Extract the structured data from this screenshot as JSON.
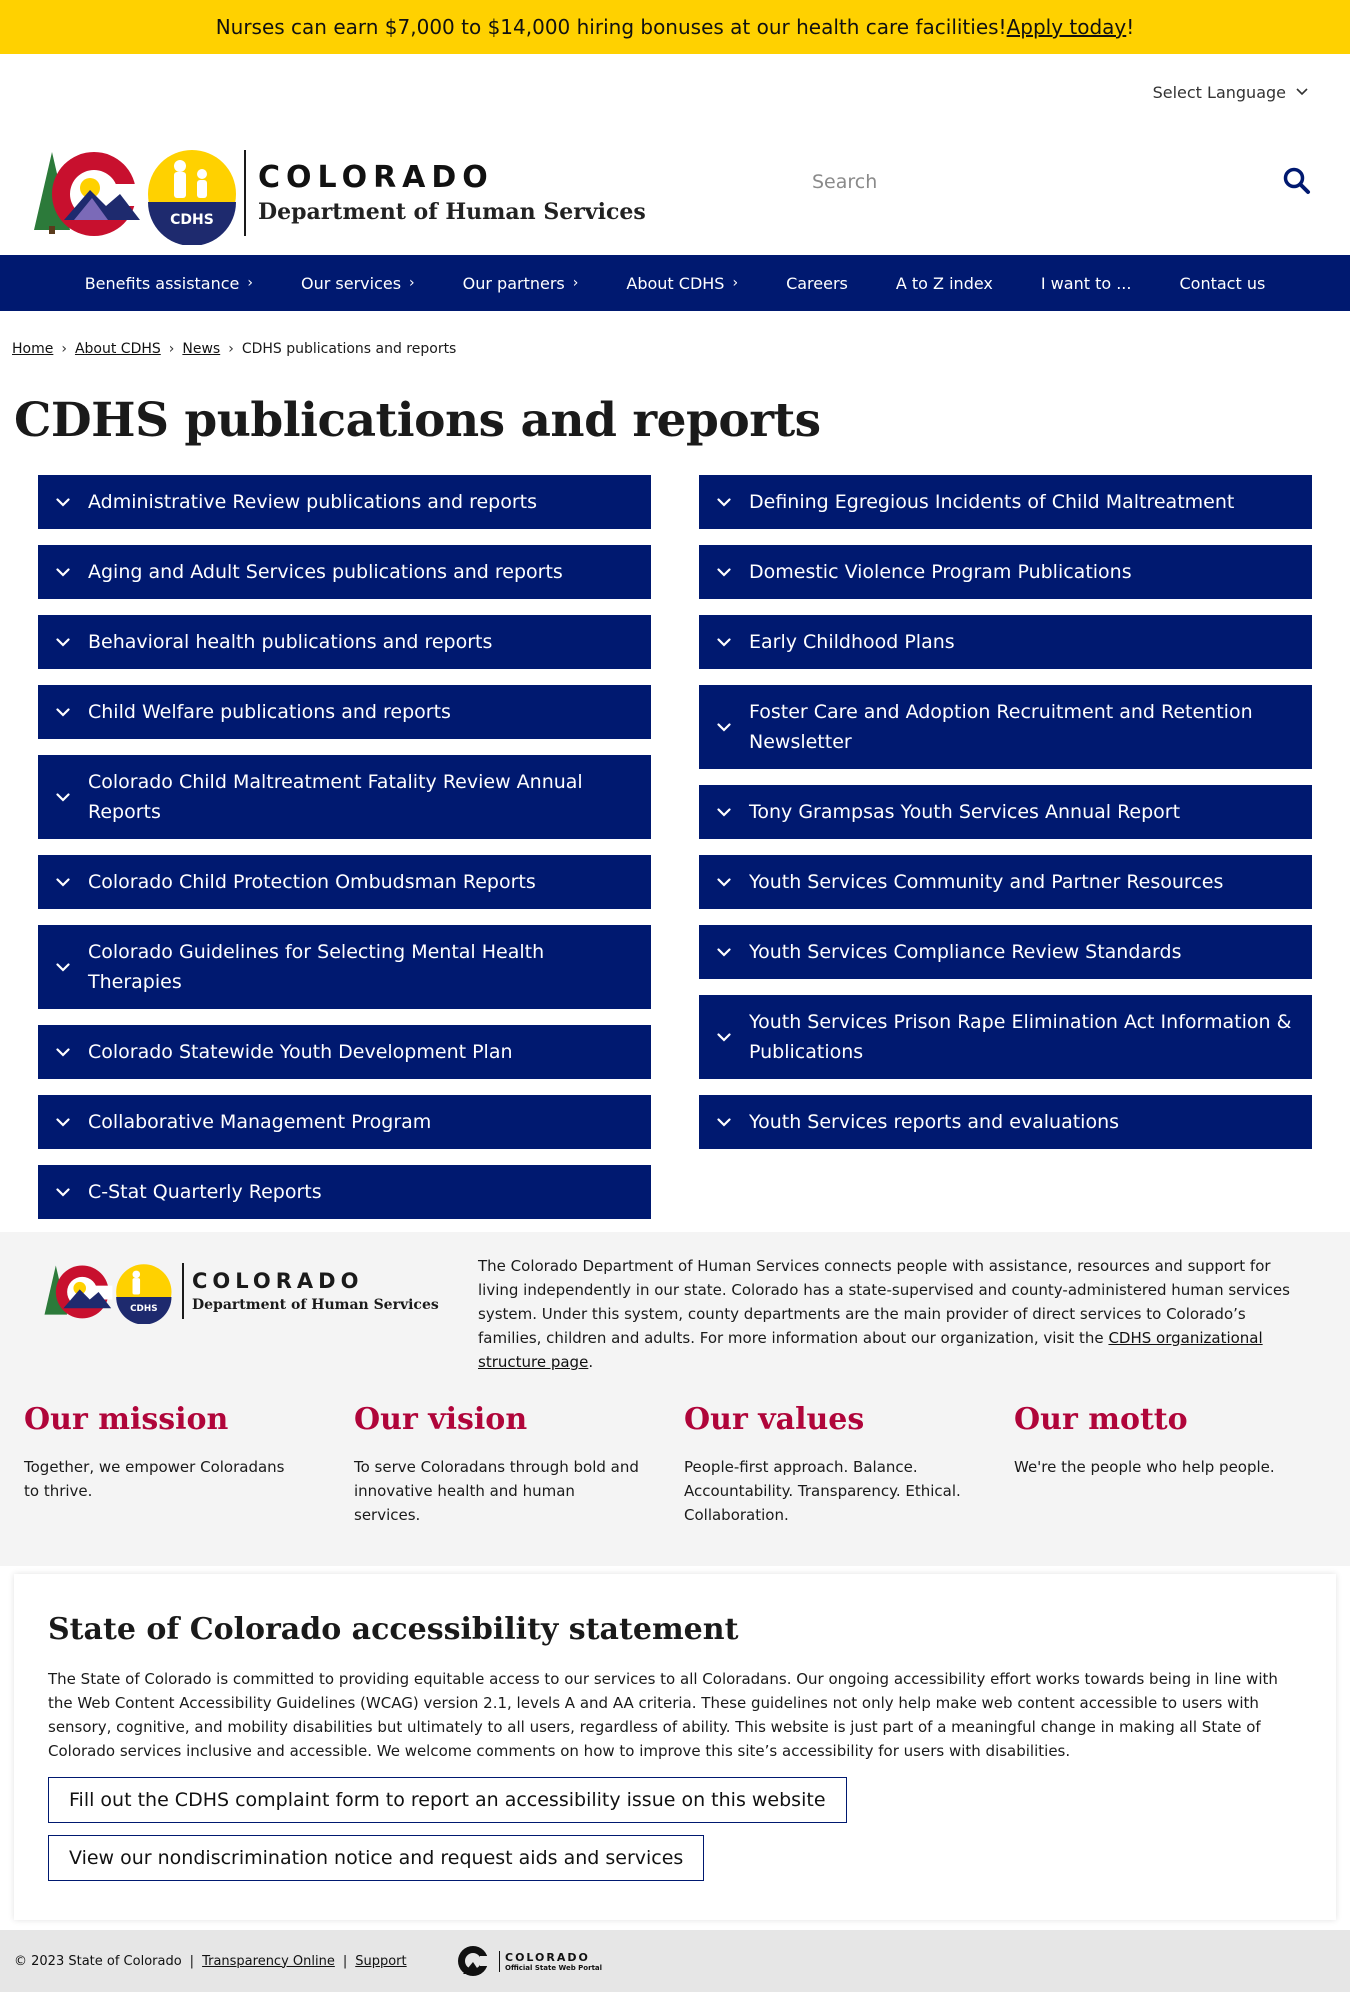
{
  "banner": {
    "text": "Nurses can earn $7,000 to $14,000 hiring bonuses at our health care facilities! ",
    "link": "Apply today",
    "suffix": "!"
  },
  "header": {
    "language_label": "Select Language",
    "logo_title": "COLORADO",
    "logo_subtitle": "Department of Human Services",
    "logo_badge": "CDHS",
    "search_placeholder": "Search"
  },
  "nav": {
    "items": [
      {
        "label": "Benefits assistance",
        "arrow": true
      },
      {
        "label": "Our services",
        "arrow": true
      },
      {
        "label": "Our partners",
        "arrow": true
      },
      {
        "label": "About CDHS",
        "arrow": true
      },
      {
        "label": "Careers",
        "arrow": false
      },
      {
        "label": "A to Z index",
        "arrow": false
      },
      {
        "label": "I want to ...",
        "arrow": false
      },
      {
        "label": "Contact us",
        "arrow": false
      }
    ]
  },
  "breadcrumb": {
    "home": "Home",
    "about": "About CDHS",
    "news": "News",
    "current": "CDHS publications and reports"
  },
  "page": {
    "title": "CDHS publications and reports"
  },
  "accordions": {
    "left": [
      "Administrative Review publications and reports",
      "Aging and Adult Services publications and reports",
      "Behavioral health publications and reports",
      "Child Welfare publications and reports",
      "Colorado Child Maltreatment Fatality Review Annual Reports",
      "Colorado Child Protection Ombudsman Reports",
      "Colorado Guidelines for Selecting Mental Health Therapies",
      "Colorado Statewide Youth Development Plan",
      "Collaborative Management Program",
      "C-Stat Quarterly Reports"
    ],
    "right": [
      "Defining Egregious Incidents of Child Maltreatment",
      "Domestic Violence Program Publications",
      "Early Childhood Plans",
      "Foster Care and Adoption Recruitment and Retention Newsletter",
      "Tony Grampsas Youth Services Annual Report",
      "Youth Services Community and Partner Resources",
      "Youth Services Compliance Review Standards",
      "Youth Services Prison Rape Elimination Act Information & Publications",
      "Youth Services reports and evaluations"
    ]
  },
  "footer": {
    "about_text": "The Colorado Department of Human Services connects people with assistance, resources and support for living independently in our state. Colorado has a state-supervised and county-administered human services system. Under this system, county departments are the main provider of direct services to Colorado’s families, children and adults. For more information about our organization, visit the ",
    "about_link": "CDHS organizational structure page",
    "about_suffix": ".",
    "mission": {
      "title": "Our mission",
      "text": "Together, we empower Coloradans to thrive."
    },
    "vision": {
      "title": "Our vision",
      "text": "To serve Coloradans through bold and innovative health and human services."
    },
    "values": {
      "title": "Our values",
      "text": "People-first approach. Balance. Accountability. Transparency. Ethical. Collaboration."
    },
    "motto": {
      "title": "Our motto",
      "text": "We're the people who help people."
    }
  },
  "accessibility": {
    "title": "State of Colorado accessibility statement",
    "text": "The State of Colorado is committed to providing equitable access to our services to all Coloradans. Our ongoing accessibility effort works towards being in line with the Web Content Accessibility Guidelines (WCAG) version 2.1, levels A and AA criteria. These guidelines not only help make web content accessible to users with sensory, cognitive, and mobility disabilities but ultimately to all users, regardless of ability. This website is just part of a meaningful change in making all State of Colorado services inclusive and accessible. We welcome comments on how to improve this site’s accessibility for users with disabilities.",
    "button1": "Fill out the CDHS complaint form to report an accessibility issue on this website",
    "button2": "View our nondiscrimination notice and request aids and services"
  },
  "bottom": {
    "copyright": "© 2023 State of Colorado",
    "transparency": "Transparency Online",
    "support": "Support",
    "portal_title": "COLORADO",
    "portal_subtitle": "Official State Web Portal"
  },
  "colors": {
    "banner": "#ffd100",
    "navy": "#001970",
    "accent_red": "#b0053a"
  }
}
